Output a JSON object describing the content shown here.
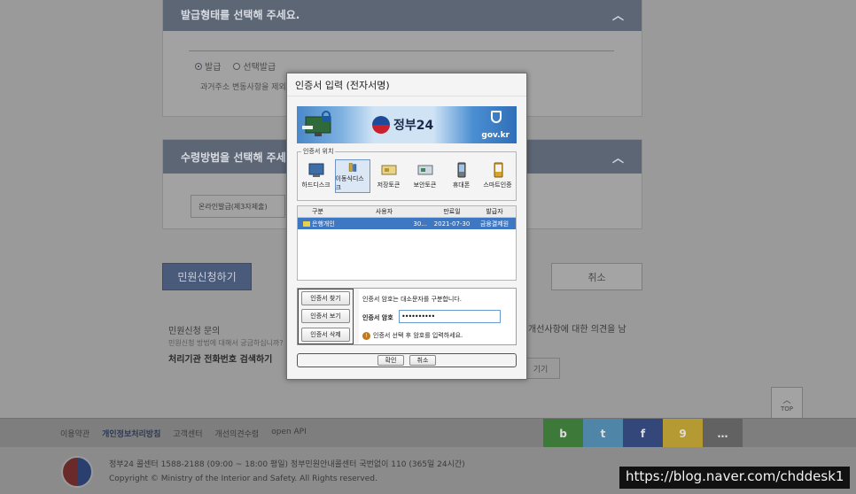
{
  "background": {
    "issue_type_section": {
      "title": "발급형태를 선택해 주세요.",
      "options": [
        "발급",
        "선택발급"
      ],
      "note": "과거주소 변동사항을 제외한 표시"
    },
    "receive_section": {
      "title": "수령방법을 선택해 주세요.",
      "value": "온라인발급(제3자제출)"
    },
    "apply_button": "민원신청하기",
    "cancel_button": "취소",
    "inquiry": {
      "title": "민원신청 문의",
      "subtitle": "민원신청 방법에 대해서 궁금하십니까?",
      "bold": "처리기관 전화번호 검색하기"
    },
    "opinion_text": "개선사항에 대한 의견을 남",
    "opinion_button": "기기",
    "top_button": "TOP"
  },
  "footer": {
    "links": [
      "이용약관",
      "개인정보처리방침",
      "고객센터",
      "개선의견수렴",
      "open API"
    ],
    "social": [
      {
        "label": "b",
        "color": "#3d7a3a"
      },
      {
        "label": "t",
        "color": "#4f86a8"
      },
      {
        "label": "f",
        "color": "#34477a"
      },
      {
        "label": "9",
        "color": "#b59a34"
      },
      {
        "label": "…",
        "color": "#626262"
      }
    ],
    "line1": "정부24 콜센터 1588-2188 (09:00 ~ 18:00 평일) 정부민원안내콜센터 국번없이 110 (365일 24시간)",
    "line2": "Copyright © Ministry of the Interior and Safety. All Rights reserved."
  },
  "watermark": "https://blog.naver.com/chddesk1",
  "dialog": {
    "title": "인증서 입력 (전자서명)",
    "banner": {
      "brand": "정부24",
      "domain": "gov.kr"
    },
    "location_legend": "인증서 위치",
    "locations": [
      {
        "label": "하드디스크",
        "icon": "hard-disk-icon",
        "selected": false
      },
      {
        "label": "이동식디스크",
        "icon": "removable-disk-icon",
        "selected": true
      },
      {
        "label": "저장토큰",
        "icon": "storage-token-icon",
        "selected": false
      },
      {
        "label": "보안토큰",
        "icon": "security-token-icon",
        "selected": false
      },
      {
        "label": "휴대폰",
        "icon": "mobile-phone-icon",
        "selected": false
      },
      {
        "label": "스마트인증",
        "icon": "smart-auth-icon",
        "selected": false
      }
    ],
    "table": {
      "headers": [
        "구분",
        "사용자",
        "만료일",
        "발급자"
      ],
      "rows": [
        {
          "type": "은행개인",
          "user": "30...",
          "expiry": "2021-07-30",
          "issuer": "금융결제원"
        }
      ]
    },
    "side_buttons": [
      "인증서 찾기",
      "인증서 보기",
      "인증서 삭제"
    ],
    "pw_info": "인증서 암호는 대소문자를 구분합니다.",
    "pw_label": "인증서 암호",
    "pw_value": "••••••••••",
    "pw_warning": "인증서 선택 후 암호를 입력하세요.",
    "confirm": "확인",
    "cancel": "취소"
  }
}
